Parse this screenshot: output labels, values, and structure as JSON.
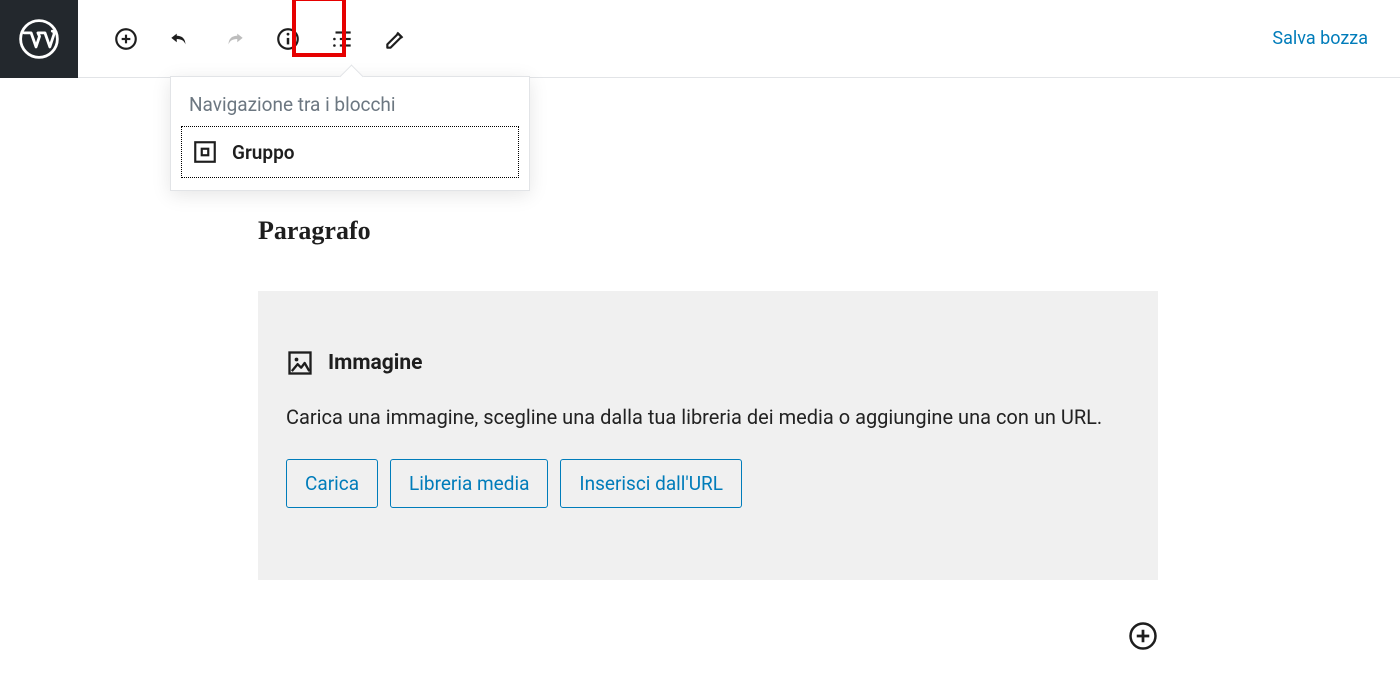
{
  "toolbar": {
    "save_draft_label": "Salva bozza"
  },
  "popover": {
    "title": "Navigazione tra i blocchi",
    "items": [
      {
        "label": "Gruppo"
      }
    ]
  },
  "editor": {
    "block_title": "Paragrafo"
  },
  "image_block": {
    "label": "Immagine",
    "description": "Carica una immagine, scegline una dalla tua libreria dei media o aggiungine una con un URL.",
    "buttons": {
      "upload": "Carica",
      "media_library": "Libreria media",
      "insert_url": "Inserisci dall'URL"
    }
  }
}
